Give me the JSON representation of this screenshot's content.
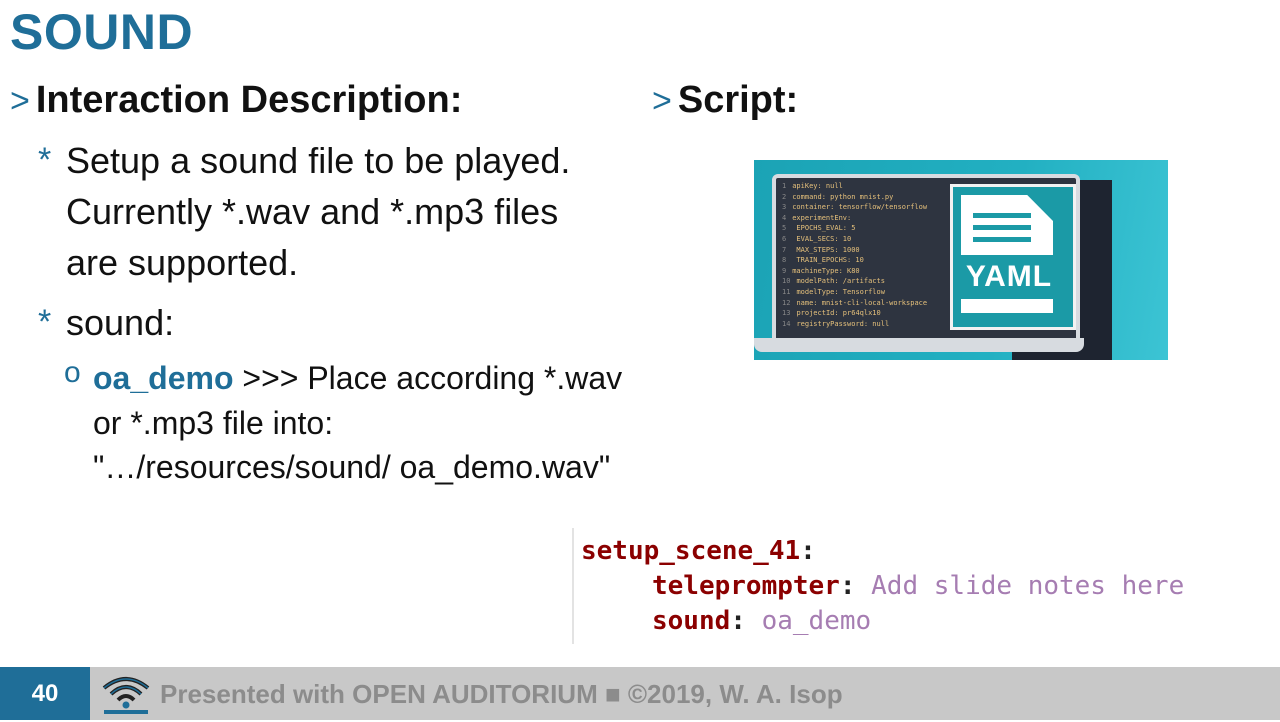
{
  "slide": {
    "title": "SOUND",
    "left_heading": "Interaction Description:",
    "right_heading": "Script:",
    "chevron": ">",
    "star": "*",
    "sub_marker": "o",
    "items": [
      "Setup a sound file to be played. Currently *.wav and *.mp3 files are supported.",
      "sound:"
    ],
    "sub_item": {
      "highlight": "oa_demo",
      "text": " >>> Place according *.wav or *.mp3 file into: \"…/resources/sound/ oa_demo.wav\""
    }
  },
  "yaml_image": {
    "label": "YAML",
    "icon": "yaml-file-icon",
    "code_lines": [
      "apiKey: null",
      "command: python mnist.py",
      "container: tensorflow/tensorflow",
      "experimentEnv:",
      "  EPOCHS_EVAL: 5",
      "  EVAL_SECS: 10",
      "  MAX_STEPS: 1000",
      "  TRAIN_EPOCHS: 10",
      "machineType: K80",
      "modelPath: /artifacts",
      "modelType: Tensorflow",
      "name: mnist-cli-local-workspace",
      "projectId: pr64qlx10",
      "registryPassword: null"
    ]
  },
  "snippet": {
    "line1_key": "setup_scene_41",
    "line2_key": "teleprompter",
    "line2_val": "Add slide notes here",
    "line3_key": "sound",
    "line3_val": "oa_demo",
    "colon": ":"
  },
  "footer": {
    "page_number": "40",
    "text": "Presented with OPEN AUDITORIUM ■ ©2019, W. A. Isop",
    "logo": "open-auditorium-wifi-logo"
  },
  "colors": {
    "accent": "#1f6e98",
    "footer_bg": "#c8c8c8",
    "snippet_key": "#8b0000",
    "snippet_value": "#a67db2",
    "yaml_teal": "#1b9aa6"
  }
}
